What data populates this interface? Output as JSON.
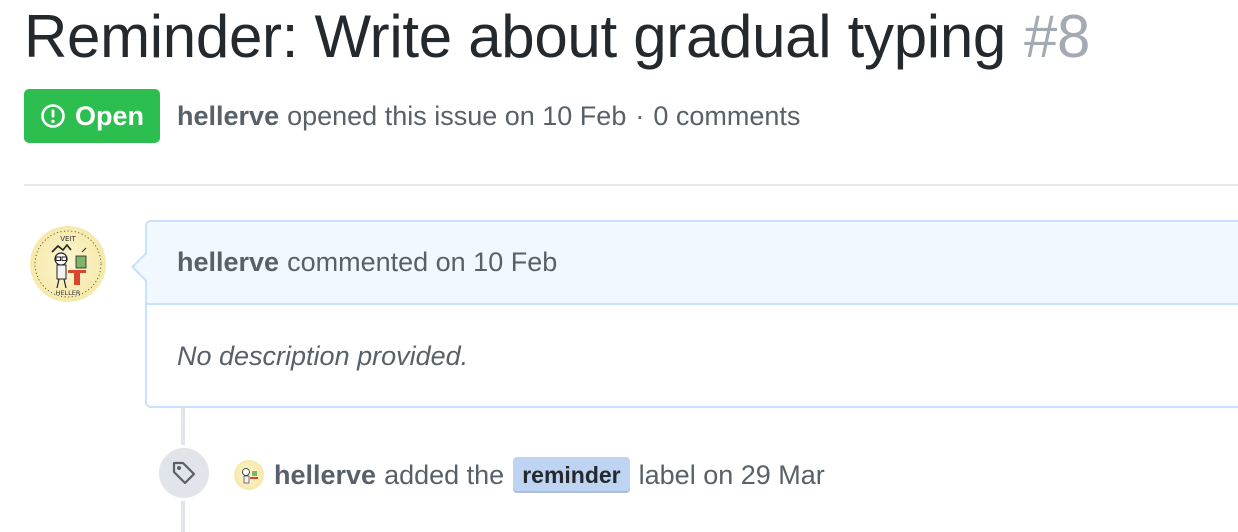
{
  "issue": {
    "title": "Reminder: Write about gradual typing",
    "number": "#8",
    "state": "Open",
    "author": "hellerve",
    "opened_text": "opened this issue on 10 Feb",
    "separator": "·",
    "comments_count": "0 comments"
  },
  "comment": {
    "author": "hellerve",
    "meta": "commented on 10 Feb",
    "body": "No description provided."
  },
  "avatar": {
    "top_text": "VEIT",
    "bottom_text": "HELLER"
  },
  "event": {
    "author": "hellerve",
    "action": "added the",
    "label": "reminder",
    "suffix": "label on 29 Mar",
    "icon": "tag-icon"
  },
  "colors": {
    "open_green": "#2cbe4e",
    "label_bg": "#bfd4f2",
    "comment_border": "#c8e1ff",
    "comment_header_bg": "#f1f8ff"
  }
}
